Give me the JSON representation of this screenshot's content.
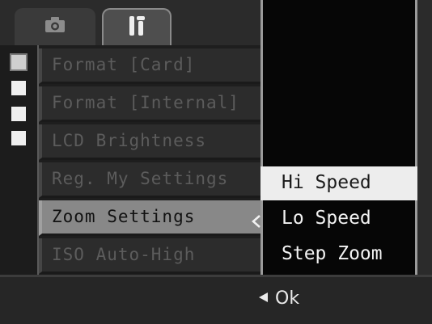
{
  "tabs": [
    {
      "id": "camera",
      "icon": "camera-icon",
      "active": false
    },
    {
      "id": "setup",
      "icon": "setup-tools-icon",
      "active": true
    }
  ],
  "menu": {
    "items": [
      {
        "label": "Format [Card]",
        "state": "disabled"
      },
      {
        "label": "Format [Internal]",
        "state": "disabled"
      },
      {
        "label": "LCD Brightness",
        "state": "disabled"
      },
      {
        "label": "Reg. My Settings",
        "state": "disabled"
      },
      {
        "label": "Zoom Settings",
        "state": "selected"
      },
      {
        "label": "ISO Auto-High",
        "state": "disabled"
      }
    ]
  },
  "submenu": {
    "items": [
      {
        "label": "Hi Speed",
        "highlighted": true
      },
      {
        "label": "Lo Speed",
        "highlighted": false
      },
      {
        "label": "Step Zoom",
        "highlighted": false
      }
    ]
  },
  "footer": {
    "icon": "left-arrow-icon",
    "ok_label": "Ok"
  },
  "colors": {
    "background": "#1e1e1e",
    "selected_item": "#888888",
    "highlighted_option": "#ededed",
    "text_light": "#f2f2f2",
    "text_dim": "#5c5c5c"
  }
}
